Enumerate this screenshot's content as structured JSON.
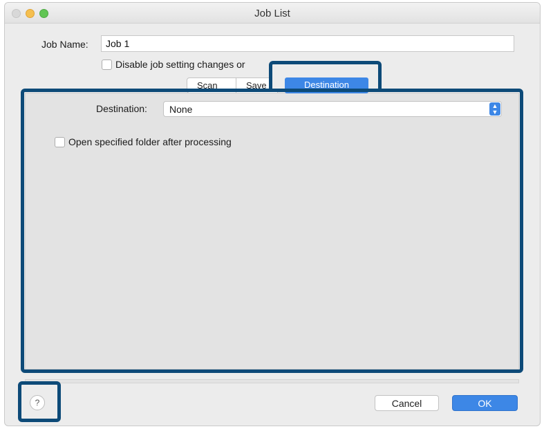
{
  "window": {
    "title": "Job List"
  },
  "job_name": {
    "label": "Job Name:",
    "value": "Job 1"
  },
  "disable_option": {
    "label": "Disable job setting changes or",
    "checked": false
  },
  "tabs": [
    {
      "label": "Scan",
      "selected": false
    },
    {
      "label": "Save",
      "selected": false
    },
    {
      "label": "Destination",
      "selected": true
    }
  ],
  "destination": {
    "label": "Destination:",
    "selected_value": "None"
  },
  "open_folder": {
    "label": "Open specified folder after processing",
    "checked": false
  },
  "footer": {
    "help_label": "?",
    "cancel_label": "Cancel",
    "ok_label": "OK"
  },
  "colors": {
    "accent": "#3d87e6",
    "highlight": "#0d4a78"
  }
}
